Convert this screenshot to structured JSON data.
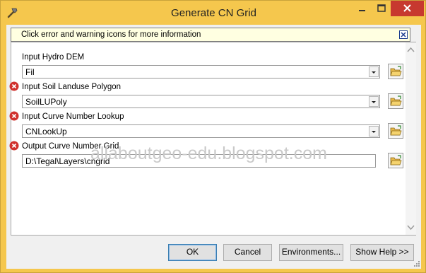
{
  "window": {
    "title": "Generate CN Grid",
    "icons": [
      "hammer-icon",
      "minimize-icon",
      "maximize-icon",
      "close-icon"
    ]
  },
  "info_bar": {
    "text": "Click error and warning icons for more information",
    "close_icon": "close-x-icon"
  },
  "params": [
    {
      "label": "Input Hydro DEM",
      "value": "Fil",
      "type": "combo",
      "error": false
    },
    {
      "label": "Input Soil Landuse Polygon",
      "value": "SoilLUPoly",
      "type": "combo",
      "error": true
    },
    {
      "label": "Input Curve Number Lookup",
      "value": "CNLookUp",
      "type": "combo",
      "error": true
    },
    {
      "label": "Output Curve Number Grid",
      "value": "D:\\Tegal\\Layers\\cngrid",
      "type": "text",
      "error": true
    }
  ],
  "watermark": "allaboutgeo-edu.blogspot.com",
  "buttons": {
    "ok": "OK",
    "cancel": "Cancel",
    "environments": "Environments...",
    "show_help": "Show Help >>"
  },
  "colors": {
    "title_bar": "#f5c74d",
    "close_button": "#c7392f",
    "error_icon": "#d0312d",
    "info_bar": "#ffffe1"
  }
}
